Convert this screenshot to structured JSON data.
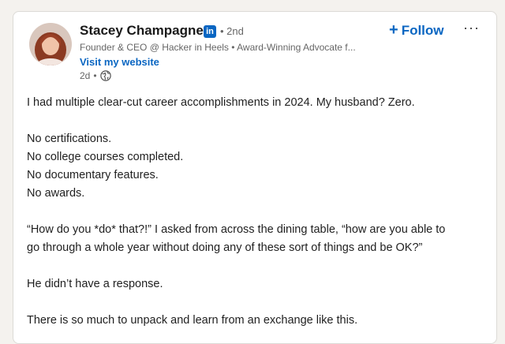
{
  "post": {
    "author": {
      "name": "Stacey Champagne",
      "badge": "in",
      "degree": "• 2nd",
      "headline": "Founder & CEO @ Hacker in Heels • Award-Winning Advocate f...",
      "website_label": "Visit my website",
      "time": "2d",
      "visibility_icon": "globe-icon"
    },
    "follow_label": "Follow",
    "follow_icon": "plus-icon",
    "more_icon": "more-options-icon",
    "more_label": "···",
    "body": [
      "I had multiple clear-cut career accomplishments in 2024. My husband? Zero.",
      "",
      "No certifications.",
      "No college courses completed.",
      "No documentary features.",
      "No awards.",
      "",
      "“How do you *do* that?!” I asked from across the dining table, “how are you able to",
      "go through a whole year without doing any of these sort of things and be OK?”",
      "",
      "He didn’t have a response.",
      "",
      "There is so much to unpack and learn from an exchange like this."
    ]
  },
  "colors": {
    "accent": "#0a66c2",
    "text": "#1f1f1f",
    "muted": "#666666"
  }
}
